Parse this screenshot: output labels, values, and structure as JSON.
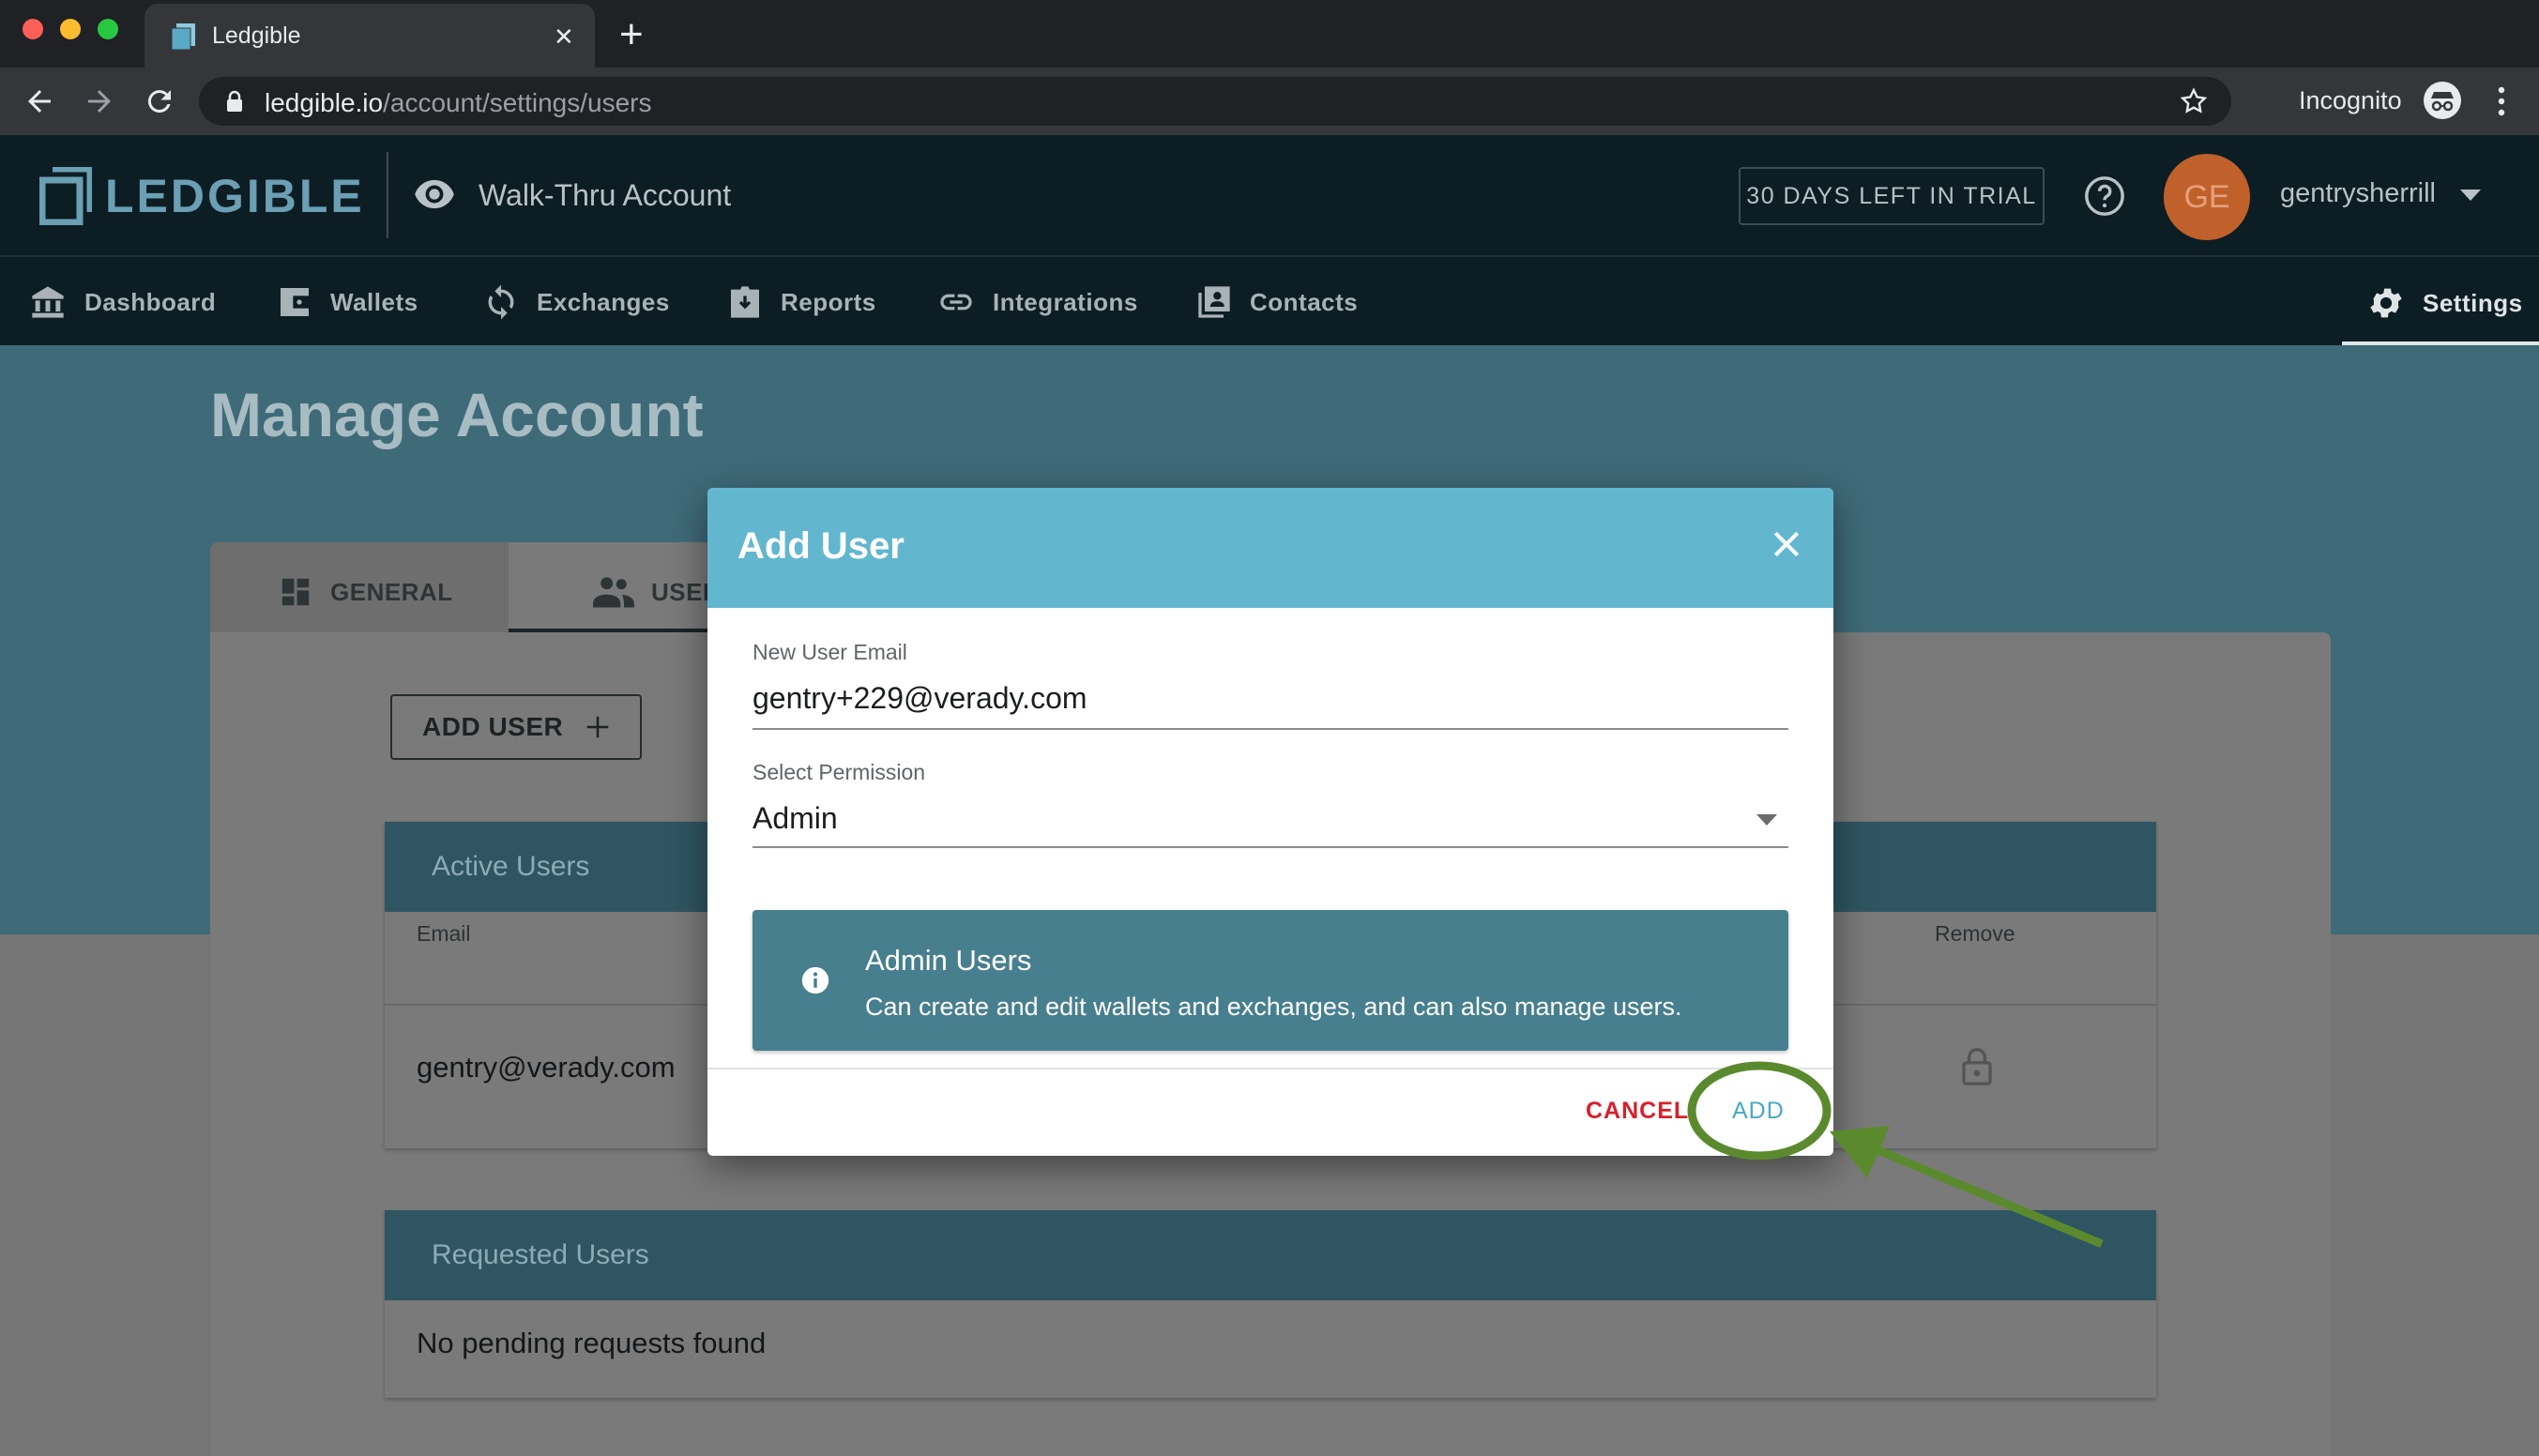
{
  "browser": {
    "tab_title": "Ledgible",
    "url_host": "ledgible.io",
    "url_path": "/account/settings/users",
    "incognito_label": "Incognito"
  },
  "header": {
    "logo_text": "LEDGIBLE",
    "account_name": "Walk-Thru Account",
    "trial_badge": "30 DAYS LEFT IN TRIAL",
    "avatar_initials": "GE",
    "username": "gentrysherrill"
  },
  "nav": {
    "items": [
      {
        "label": "Dashboard",
        "icon": "bank-icon"
      },
      {
        "label": "Wallets",
        "icon": "wallet-icon"
      },
      {
        "label": "Exchanges",
        "icon": "sync-icon"
      },
      {
        "label": "Reports",
        "icon": "report-icon"
      },
      {
        "label": "Integrations",
        "icon": "link-icon"
      },
      {
        "label": "Contacts",
        "icon": "contacts-icon"
      }
    ],
    "settings_label": "Settings"
  },
  "page": {
    "title": "Manage Account",
    "tabs": [
      {
        "label": "GENERAL",
        "icon": "dashboard-icon"
      },
      {
        "label": "USERS",
        "icon": "people-icon"
      }
    ],
    "add_user_label": "ADD USER",
    "active_users": {
      "title": "Active Users",
      "columns": [
        "Email",
        "Remove"
      ],
      "rows": [
        {
          "email": "gentry@verady.com"
        }
      ]
    },
    "requested_users": {
      "title": "Requested Users",
      "empty_text": "No pending requests found"
    }
  },
  "modal": {
    "title": "Add User",
    "email_label": "New User Email",
    "email_value": "gentry+229@verady.com",
    "permission_label": "Select Permission",
    "permission_value": "Admin",
    "info_title": "Admin Users",
    "info_text": "Can create and edit wallets and exchanges, and can also manage users.",
    "cancel_label": "CANCEL",
    "add_label": "ADD"
  },
  "colors": {
    "modal_header": "#62b7cf",
    "annotation": "#5b8a2e",
    "cancel": "#d8202a"
  }
}
